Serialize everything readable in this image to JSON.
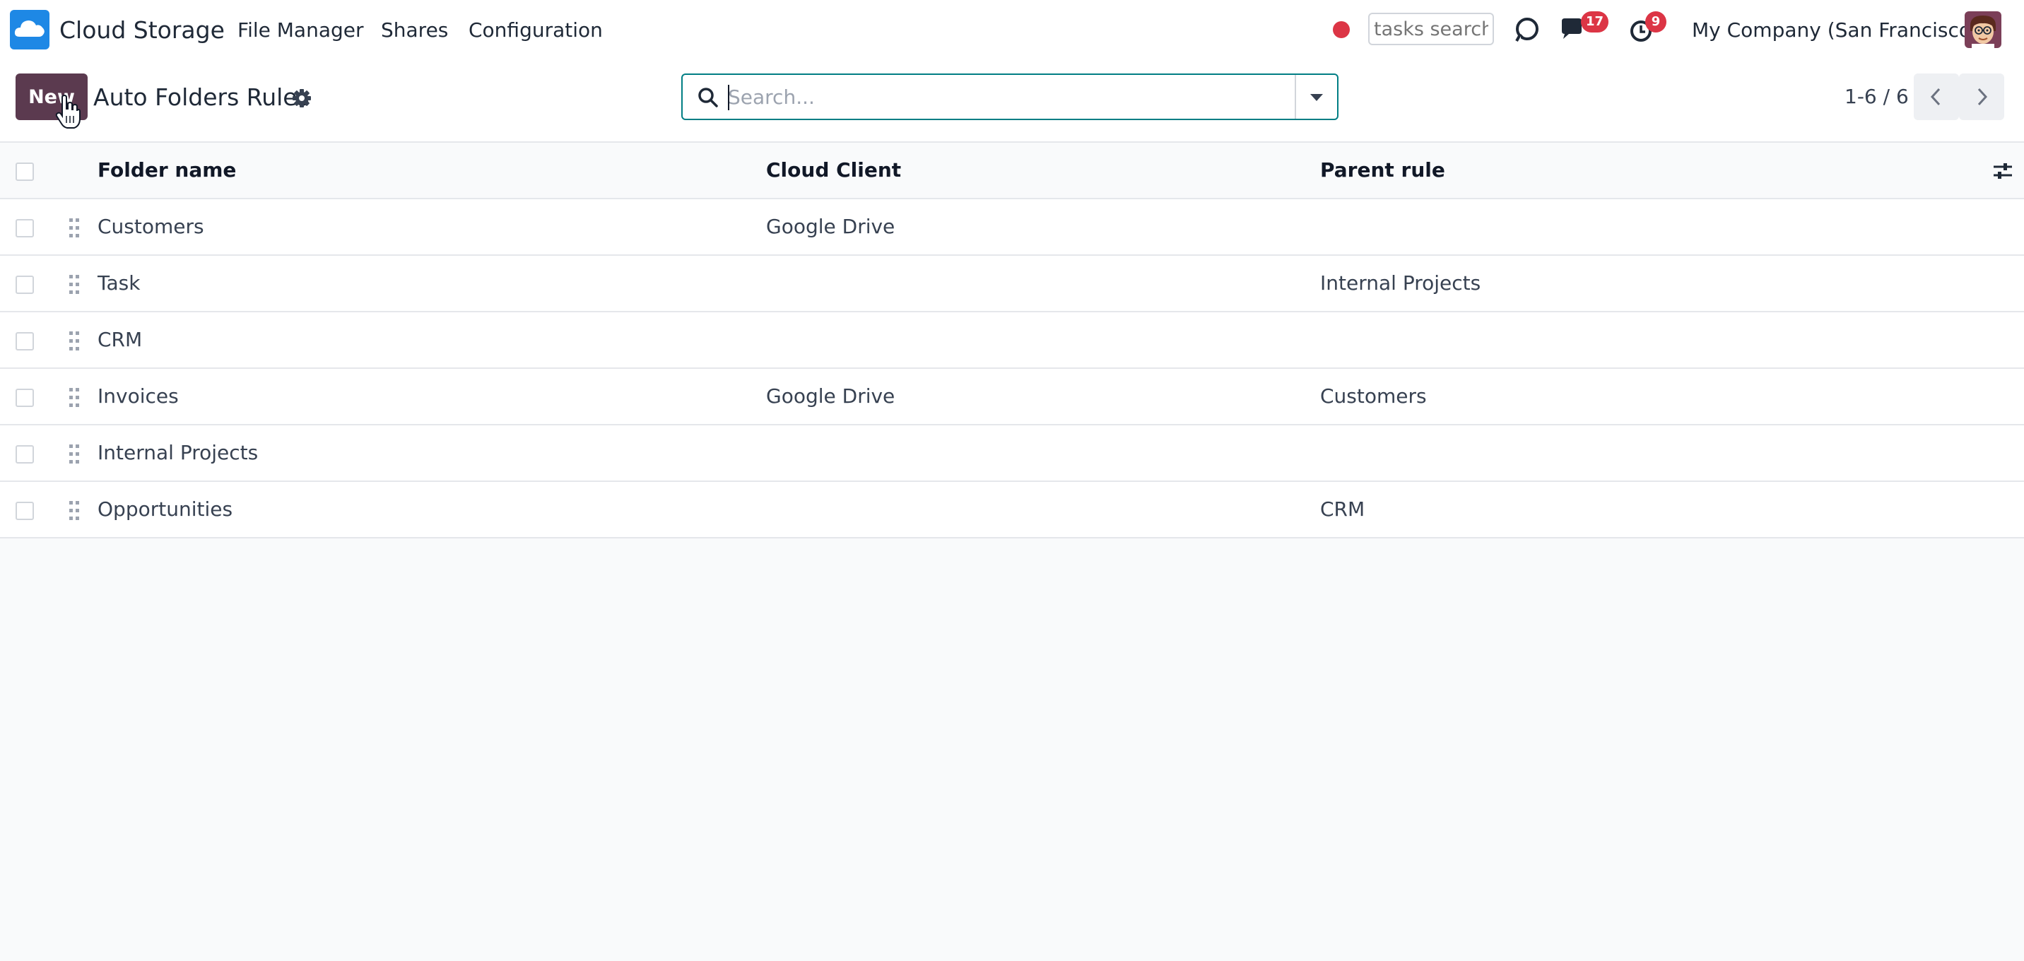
{
  "navbar": {
    "app_name": "Cloud Storage",
    "menu": [
      "File Manager",
      "Shares",
      "Configuration"
    ],
    "tasks_search_placeholder": "tasks search",
    "messages_count": "17",
    "activities_count": "9",
    "company": "My Company (San Francisco)"
  },
  "control_panel": {
    "new_label": "New",
    "title": "Auto Folders Rules",
    "search_placeholder": "Search...",
    "pager_value": "1-6 / 6"
  },
  "table": {
    "columns": [
      "Folder name",
      "Cloud Client",
      "Parent rule"
    ],
    "rows": [
      {
        "folder": "Customers",
        "client": "Google Drive",
        "parent": ""
      },
      {
        "folder": "Task",
        "client": "",
        "parent": "Internal Projects"
      },
      {
        "folder": "CRM",
        "client": "",
        "parent": ""
      },
      {
        "folder": "Invoices",
        "client": "Google Drive",
        "parent": "Customers"
      },
      {
        "folder": "Internal Projects",
        "client": "",
        "parent": ""
      },
      {
        "folder": "Opportunities",
        "client": "",
        "parent": "CRM"
      }
    ]
  },
  "colors": {
    "primary": "#5b3a4f",
    "search_border": "#017e84",
    "badge": "#dc3545",
    "logo": "#1e88e5"
  },
  "icons": [
    "cloud-logo-icon",
    "record-dot-icon",
    "discuss-icon",
    "chat-icon",
    "clock-icon",
    "gear-icon",
    "search-icon",
    "caret-down-icon",
    "chevron-left-icon",
    "chevron-right-icon",
    "drag-handle-icon",
    "column-settings-icon",
    "hand-cursor-icon"
  ]
}
